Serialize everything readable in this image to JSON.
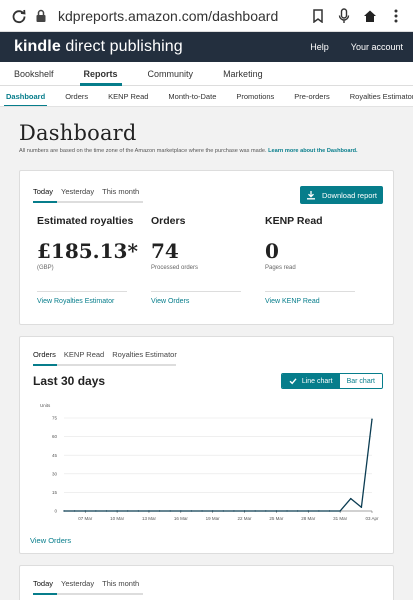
{
  "browser": {
    "url": "kdpreports.amazon.com/dashboard"
  },
  "header": {
    "logo_prefix": "kindle",
    "logo_suffix": "direct publishing",
    "help": "Help",
    "account": "Your account"
  },
  "main_nav": [
    "Bookshelf",
    "Reports",
    "Community",
    "Marketing"
  ],
  "sub_nav": [
    "Dashboard",
    "Orders",
    "KENP Read",
    "Month-to-Date",
    "Promotions",
    "Pre-orders",
    "Royalties Estimator"
  ],
  "page": {
    "title": "Dashboard",
    "note": "All numbers are based on the time zone of the Amazon marketplace where the purchase was made.",
    "note_link": "Learn more about the Dashboard."
  },
  "summary": {
    "tabs": [
      "Today",
      "Yesterday",
      "This month"
    ],
    "download": "Download report",
    "metrics": [
      {
        "heading": "Estimated royalties",
        "value": "£185.13*",
        "sub": "(GBP)",
        "link": "View Royalties Estimator"
      },
      {
        "heading": "Orders",
        "value": "74",
        "sub": "Processed orders",
        "link": "View Orders"
      },
      {
        "heading": "KENP Read",
        "value": "0",
        "sub": "Pages read",
        "link": "View KENP Read"
      }
    ]
  },
  "chart_card": {
    "tabs": [
      "Orders",
      "KENP Read",
      "Royalties Estimator"
    ],
    "title": "Last 30 days",
    "line_label": "Line chart",
    "bar_label": "Bar chart",
    "link": "View Orders"
  },
  "chart_data": {
    "type": "line",
    "ylabel": "Units",
    "ylim": [
      0,
      75
    ],
    "yticks": [
      0,
      15,
      30,
      45,
      60,
      75
    ],
    "x_tick_labels": [
      "07 Mar",
      "10 Mar",
      "13 Mar",
      "16 Mar",
      "19 Mar",
      "22 Mar",
      "25 Mar",
      "28 Mar",
      "31 Mar",
      "03 Apr"
    ],
    "x": [
      "05 Mar",
      "06 Mar",
      "07 Mar",
      "08 Mar",
      "09 Mar",
      "10 Mar",
      "11 Mar",
      "12 Mar",
      "13 Mar",
      "14 Mar",
      "15 Mar",
      "16 Mar",
      "17 Mar",
      "18 Mar",
      "19 Mar",
      "20 Mar",
      "21 Mar",
      "22 Mar",
      "23 Mar",
      "24 Mar",
      "25 Mar",
      "26 Mar",
      "27 Mar",
      "28 Mar",
      "29 Mar",
      "30 Mar",
      "31 Mar",
      "01 Apr",
      "02 Apr",
      "03 Apr"
    ],
    "series": [
      {
        "values": [
          0,
          0,
          0,
          0,
          0,
          0,
          0,
          0,
          0,
          0,
          0,
          0,
          0,
          0,
          0,
          0,
          0,
          0,
          0,
          0,
          0,
          0,
          0,
          0,
          0,
          0,
          0,
          10,
          3,
          74
        ]
      }
    ],
    "color": "#0b3c52",
    "grid": true
  },
  "bottom_card": {
    "tabs": [
      "Today",
      "Yesterday",
      "This month"
    ]
  },
  "colors": {
    "accent": "#067d8b",
    "header_bg": "#232f3e"
  }
}
